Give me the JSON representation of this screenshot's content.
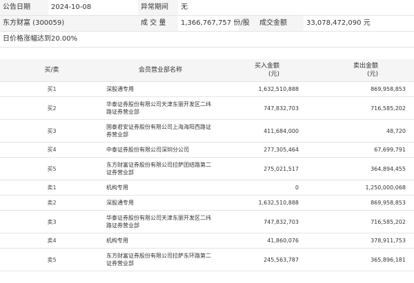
{
  "header": {
    "date_label": "公告日期",
    "date_value": "2024-10-08",
    "anomaly_label": "异常期间",
    "anomaly_value": "无",
    "stock": "东方财富 (300059)",
    "volume_label": "成 交 量",
    "volume_value": "1,366,767,757 份/股",
    "amount_label": "成交金额",
    "amount_value": "33,078,472,090 元",
    "reason": "日价格涨幅达到20.00%"
  },
  "table": {
    "headers": {
      "side": "买/卖",
      "dept": "会员营业部名称",
      "buy": "买入金额\n(元)",
      "sell": "卖出金额\n(元)"
    },
    "rows": [
      {
        "side": "买1",
        "dept": "深股通专用",
        "buy": "1,632,510,888",
        "sell": "869,958,853"
      },
      {
        "side": "买2",
        "dept": "华泰证券股份有限公司天津东丽开发区二纬路证券营业部",
        "buy": "747,832,703",
        "sell": "716,585,202"
      },
      {
        "side": "买3",
        "dept": "国泰君安证券股份有限公司上海海阳西路证券营业部",
        "buy": "411,684,000",
        "sell": "48,720"
      },
      {
        "side": "买4",
        "dept": "中泰证券股份有限公司深圳分公司",
        "buy": "277,305,464",
        "sell": "67,699,791"
      },
      {
        "side": "买5",
        "dept": "东方财富证券股份有限公司拉萨团结路第二证券营业部",
        "buy": "275,021,517",
        "sell": "364,894,455"
      },
      {
        "side": "卖1",
        "dept": "机构专用",
        "buy": "0",
        "sell": "1,250,000,068"
      },
      {
        "side": "卖2",
        "dept": "深股通专用",
        "buy": "1,632,510,888",
        "sell": "869,958,853"
      },
      {
        "side": "卖3",
        "dept": "华泰证券股份有限公司天津东丽开发区二纬路证券营业部",
        "buy": "747,832,703",
        "sell": "716,585,202"
      },
      {
        "side": "卖4",
        "dept": "机构专用",
        "buy": "41,860,076",
        "sell": "378,911,753"
      },
      {
        "side": "卖5",
        "dept": "东方财富证券股份有限公司拉萨东环路第二证券营业部",
        "buy": "245,563,787",
        "sell": "365,896,181"
      }
    ]
  }
}
